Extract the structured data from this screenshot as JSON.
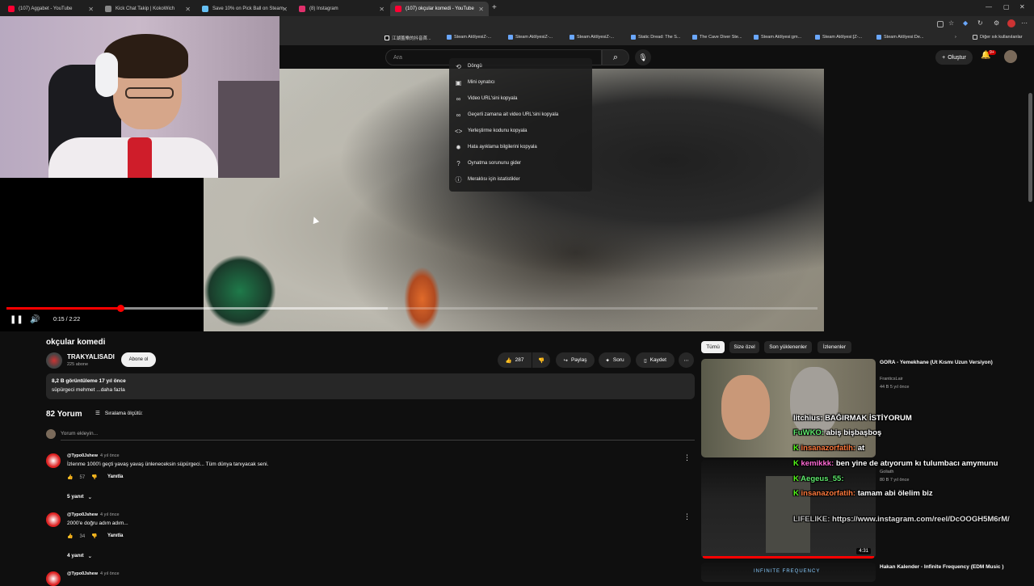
{
  "browser": {
    "tabs": [
      {
        "label": "(107) Aggabet - YouTube",
        "color": "#ff0033"
      },
      {
        "label": "Kick Chat Takip | KokoWich",
        "color": "#888888"
      },
      {
        "label": "Save 10% on Pick Ball on Steam",
        "color": "#66c0f4"
      },
      {
        "label": "(8) Instagram",
        "color": "#e1306c"
      },
      {
        "label": "(107) okçular komedi - YouTube",
        "color": "#ff0033"
      }
    ],
    "new_tab_icon": "plus-icon",
    "bookmarks": [
      "江湖蓋樂的抖音首...",
      "Steam AtölyesiZ-...",
      "Steam AtölyesiZ-...",
      "Steam AtölyesiZ-...",
      "Static Dread: The S...",
      "The Cave Diver Ste...",
      "Steam Atölyesi:gm...",
      "Steam Atölyesi:[Z-...",
      "Steam Atölyesi:De..."
    ],
    "other_bookmarks": "Diğer sık kullanılanlar"
  },
  "header": {
    "search_placeholder": "Ara",
    "create_label": "Oluştur",
    "notif_badge": "9+"
  },
  "player": {
    "time": "0:15 / 2:22",
    "progress": 0.14,
    "buffered": 0.47,
    "context_menu": [
      {
        "icon": "loop-icon",
        "label": "Döngü"
      },
      {
        "icon": "miniplayer-icon",
        "label": "Mini oynatıcı"
      },
      {
        "icon": "link-icon",
        "label": "Video URL'sini kopyala"
      },
      {
        "icon": "link-time-icon",
        "label": "Geçerli zamana ait video URL'sini kopyala"
      },
      {
        "icon": "embed-icon",
        "label": "Yerleştirme kodunu kopyala"
      },
      {
        "icon": "bug-icon",
        "label": "Hata ayıklama bilgilerini kopyala"
      },
      {
        "icon": "help-icon",
        "label": "Oynatma sorununu gider"
      },
      {
        "icon": "info-icon",
        "label": "Meraklısı için istatistikler"
      }
    ]
  },
  "video": {
    "title": "okçular komedi",
    "channel": "TRAKYALISADI",
    "subscribers": "225 abone",
    "subscribe_label": "Abone ol",
    "likes": "287",
    "share_label": "Paylaş",
    "ask_label": "Soru",
    "save_label": "Kaydet",
    "stats": "8,2 B görüntüleme  17 yıl önce",
    "description": "süpürgeci mehmet ...daha fazla"
  },
  "comments": {
    "count_label": "82 Yorum",
    "sort_label": "Sıralama ölçütü:",
    "add_placeholder": "Yorum ekleyin...",
    "reply_label": "Yanıtla",
    "items": [
      {
        "author": "@Typo0Jshew",
        "time": "4 yıl önce",
        "text": "İzlenme 1000'i geçti yavaş yavaş ünleneceksin süpürgeci... Tüm dünya tanıyacak seni.",
        "likes": "57",
        "replies": "5 yanıt"
      },
      {
        "author": "@Typo0Jshew",
        "time": "4 yıl önce",
        "text": "2000'e doğru adım adım...",
        "likes": "34",
        "replies": "4 yanıt"
      },
      {
        "author": "@Typo0Jshew",
        "time": "4 yıl önce"
      }
    ]
  },
  "sidebar": {
    "chips": [
      "Tümü",
      "Size özel",
      "Son yüklenenler",
      "İzlenenler"
    ],
    "recs": [
      {
        "title": "GORA - Yemekhane (Ut Kısmı Uzun Versiyon)",
        "channel": "FranticsLair",
        "meta": "44 B  5 yıl önce"
      },
      {
        "title": "",
        "channel": "Goliath",
        "meta": "80 B  7 yıl önce",
        "duration": "4:31"
      },
      {
        "title": "Hakan Kalender - Infinite Frequency (EDM Music )",
        "thumb_text": "INFINITE FREQUENCY"
      }
    ]
  },
  "chat": [
    {
      "user": "litchius:",
      "text": "BAĞIRMAK İSTİYORUM"
    },
    {
      "user": "FuWKO:",
      "text": "abiş bişbaşboş"
    },
    {
      "user": "insanazorfatih:",
      "text": "at"
    },
    {
      "user": "kemikkk:",
      "text": "ben yine de atıyorum kı tulumbacı amymunu"
    },
    {
      "user": "Aegeus_55:",
      "text": ""
    },
    {
      "user": "insanazorfatih:",
      "text": "tamam abi ölelim biz"
    },
    {
      "user": "LIFELIKE:",
      "text": "https://www.instagram.com/reel/DcOOGH5M6rM/"
    }
  ]
}
